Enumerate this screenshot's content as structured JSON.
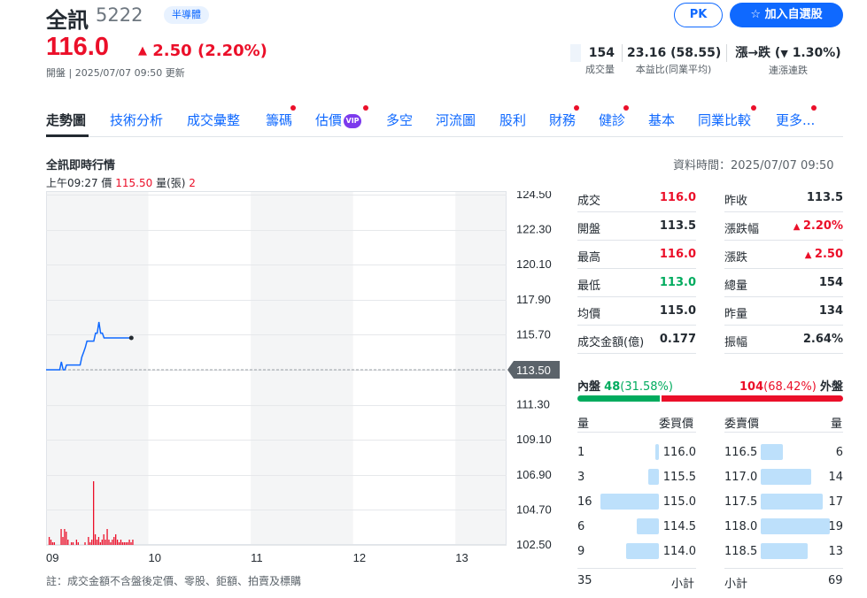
{
  "header": {
    "name": "全訊",
    "code": "5222",
    "sector": "半導體",
    "pk_label": "PK",
    "watchlist_label": "加入自選股",
    "price": "116.0",
    "change": "2.50",
    "change_pct": "(2.20%)",
    "status": "開盤 | 2025/07/07 09:50 更新"
  },
  "stats": [
    {
      "value": "154",
      "label": "成交量"
    },
    {
      "value": "23.16 (58.55)",
      "label": "本益比(同業平均)"
    },
    {
      "value_prefix": "漲→跌 (",
      "value_pct": "1.30%)",
      "label": "連漲連跌"
    }
  ],
  "tabs": [
    "走勢圖",
    "技術分析",
    "成交彙整",
    "籌碼",
    "估價",
    "多空",
    "河流圖",
    "股利",
    "財務",
    "健診",
    "基本",
    "同業比較",
    "更多..."
  ],
  "vip_label": "VIP",
  "chart": {
    "title": "全訊即時行情",
    "data_time": "資料時間：2025/07/07 09:50",
    "hover_time": "上午09:27",
    "hover_price_label": "價",
    "hover_price": "115.50",
    "hover_vol_label": "量(張)",
    "hover_vol": "2",
    "footnote": "註：成交金額不含盤後定價、零股、鉅額、拍賣及標購"
  },
  "chart_data": {
    "type": "line",
    "y_ticks": [
      "124.50",
      "122.30",
      "120.10",
      "117.90",
      "115.70",
      "113.50",
      "111.30",
      "109.10",
      "106.90",
      "104.70",
      "102.50"
    ],
    "x_ticks": [
      "09",
      "10",
      "11",
      "12",
      "13"
    ],
    "ylim": [
      102.5,
      124.5
    ],
    "reference_price": "113.50",
    "price_series": {
      "minutes": [
        0,
        8,
        9,
        10,
        11,
        12,
        13,
        14,
        15,
        16,
        17,
        18,
        19,
        20,
        21,
        22,
        23,
        24,
        25,
        26,
        27,
        28,
        29,
        30,
        31,
        32,
        33,
        34,
        35,
        36,
        37,
        38,
        39,
        40,
        41,
        42,
        43,
        44,
        45,
        46,
        47,
        48,
        49,
        50
      ],
      "prices": [
        113.5,
        113.5,
        114.0,
        113.5,
        113.5,
        113.8,
        113.8,
        113.8,
        113.8,
        113.8,
        113.8,
        113.8,
        113.8,
        113.8,
        114.3,
        114.6,
        114.9,
        115.3,
        115.3,
        115.3,
        115.3,
        115.3,
        115.8,
        115.8,
        116.5,
        115.8,
        115.8,
        115.5,
        115.5,
        115.5,
        115.5,
        115.5,
        115.5,
        115.5,
        115.5,
        115.5,
        115.5,
        115.5,
        115.5,
        115.5,
        115.5,
        115.5,
        115.5,
        115.5
      ]
    },
    "volume_series": {
      "minutes": [
        1,
        2,
        3,
        4,
        8,
        9,
        10,
        11,
        12,
        14,
        15,
        17,
        18,
        22,
        24,
        25,
        26,
        27,
        28,
        29,
        30,
        31,
        32,
        33,
        34,
        35,
        36,
        37,
        38,
        39,
        40,
        41,
        42,
        43,
        44,
        45,
        46,
        47,
        48,
        49,
        50
      ],
      "volumes": [
        3,
        2,
        1,
        1,
        6,
        3,
        6,
        5,
        2,
        1,
        1,
        2,
        1,
        1,
        3,
        1,
        2,
        24,
        4,
        2,
        3,
        1,
        2,
        4,
        2,
        6,
        2,
        1,
        2,
        3,
        4,
        2,
        1,
        2,
        1,
        1,
        1,
        1,
        2,
        1,
        2
      ]
    }
  },
  "colors": {
    "up": "#eb0f29",
    "down": "#00ab5e",
    "accent": "#0f69ff"
  },
  "quote": {
    "left": [
      {
        "label": "成交",
        "value": "116.0",
        "color": "up"
      },
      {
        "label": "開盤",
        "value": "113.5",
        "color": "flat"
      },
      {
        "label": "最高",
        "value": "116.0",
        "color": "up"
      },
      {
        "label": "最低",
        "value": "113.0",
        "color": "down"
      },
      {
        "label": "均價",
        "value": "115.0",
        "color": "flat"
      },
      {
        "label": "成交金額(億)",
        "value": "0.177",
        "color": "flat"
      }
    ],
    "right": [
      {
        "label": "昨收",
        "value": "113.5",
        "color": "flat"
      },
      {
        "label": "漲跌幅",
        "value": "2.20%",
        "color": "up",
        "arrow": true
      },
      {
        "label": "漲跌",
        "value": "2.50",
        "color": "up",
        "arrow": true
      },
      {
        "label": "總量",
        "value": "154",
        "color": "flat"
      },
      {
        "label": "昨量",
        "value": "134",
        "color": "flat"
      },
      {
        "label": "振幅",
        "value": "2.64%",
        "color": "flat"
      }
    ]
  },
  "orderbook": {
    "inner_label": "內盤",
    "inner_value": "48",
    "inner_pct": "(31.58%)",
    "outer_value": "104",
    "outer_pct": "(68.42%)",
    "outer_label": "外盤",
    "inner_ratio": 0.3158,
    "headers": {
      "bid_vol": "量",
      "bid_price": "委買價",
      "ask_price": "委賣價",
      "ask_vol": "量"
    },
    "bids": [
      {
        "vol": "1",
        "price": "116.0"
      },
      {
        "vol": "3",
        "price": "115.5"
      },
      {
        "vol": "16",
        "price": "115.0"
      },
      {
        "vol": "6",
        "price": "114.5"
      },
      {
        "vol": "9",
        "price": "114.0"
      }
    ],
    "asks": [
      {
        "price": "116.5",
        "vol": "6"
      },
      {
        "price": "117.0",
        "vol": "14"
      },
      {
        "price": "117.5",
        "vol": "17"
      },
      {
        "price": "118.0",
        "vol": "19"
      },
      {
        "price": "118.5",
        "vol": "13"
      }
    ],
    "bid_total": "35",
    "bid_total_label": "小計",
    "ask_total_label": "小計",
    "ask_total": "69"
  }
}
